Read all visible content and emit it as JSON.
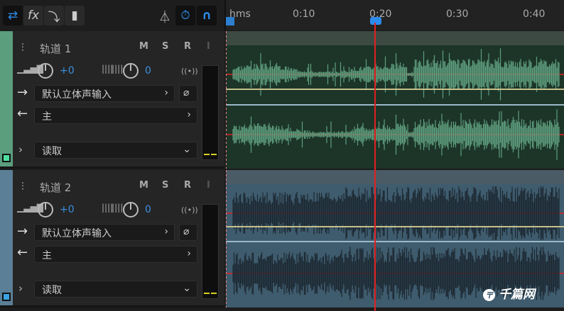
{
  "toolbar": {
    "buttons": [
      {
        "icon": "swap-arrows-icon",
        "glyph": "⇄",
        "active": true
      },
      {
        "icon": "fx-icon",
        "glyph": "fx",
        "active": false
      },
      {
        "icon": "send-routing-icon",
        "glyph": "⤵",
        "active": false
      },
      {
        "icon": "eq-bars-icon",
        "glyph": "▮",
        "active": false
      }
    ],
    "right": [
      {
        "icon": "metronome-icon",
        "glyph": "⏃"
      },
      {
        "icon": "time-stretch-icon",
        "glyph": "⏱"
      },
      {
        "icon": "snap-magnet-icon",
        "glyph": "∩"
      }
    ]
  },
  "ruler": {
    "unit": "hms",
    "ticks": [
      "0:10",
      "0:20",
      "0:30",
      "0:40"
    ]
  },
  "tracks": [
    {
      "name": "轨道 1",
      "m": "M",
      "s": "S",
      "r": "R",
      "i": "I",
      "volume": "+0",
      "pan": "0",
      "input": "默认立体声输入",
      "output": "主",
      "automation": "读取",
      "color": "#5a9e7d",
      "lane_bg": "#1c3528",
      "wave": "#5f9e7e"
    },
    {
      "name": "轨道 2",
      "m": "M",
      "s": "S",
      "r": "R",
      "i": "I",
      "volume": "+0",
      "pan": "0",
      "input": "默认立体声输入",
      "output": "主",
      "automation": "读取",
      "color": "#5b7f96",
      "lane_bg": "#3f5c6e",
      "wave": "#1b2730"
    }
  ],
  "colors": {
    "playhead": "#e02020",
    "accent": "#2d8ceb",
    "volume_line": "#c8c08a",
    "pan_line": "#9ab8c8"
  },
  "watermark": "千篇网"
}
